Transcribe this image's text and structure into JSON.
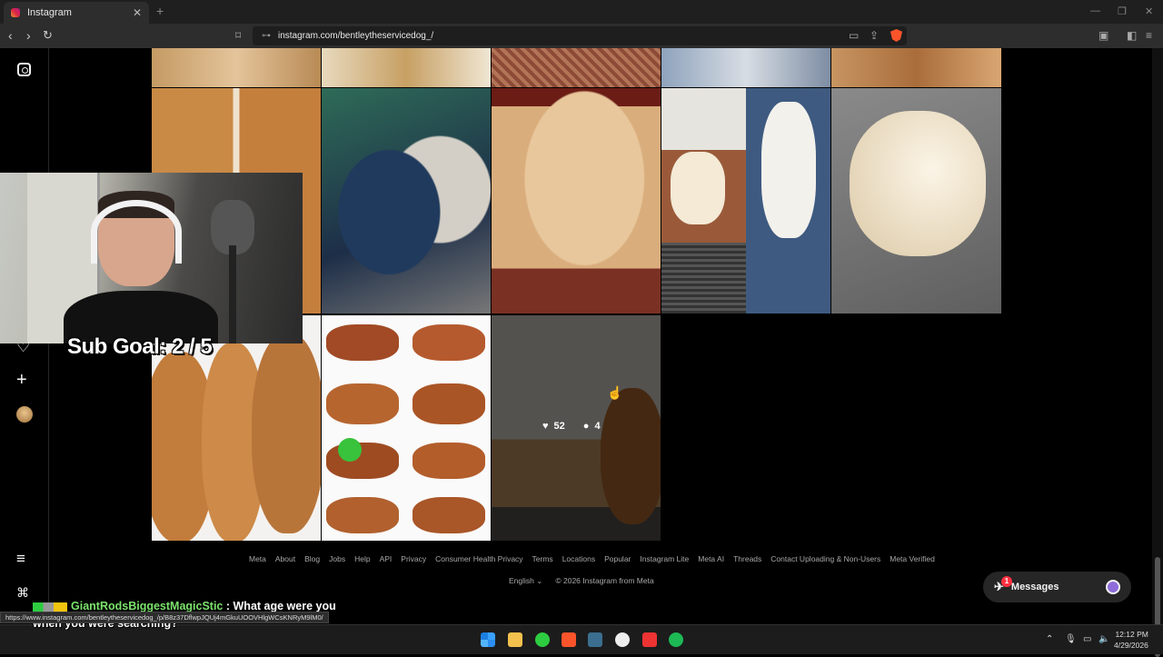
{
  "browser": {
    "tab_title": "Instagram",
    "tab_close": "✕",
    "new_tab": "+",
    "url": "instagram.com/bentleytheservicedog_/",
    "status_url": "https://www.instagram.com/bentleytheservicedog_/p/B8z37DflwpJQUj4mGkuUOOVHlgWCsKNRyM9lM0/"
  },
  "post_hover": {
    "likes": "52",
    "comments": "4"
  },
  "stream": {
    "sub_goal": "Sub Goal: 2 / 5",
    "chat_user": "GiantRodsBiggestMagicStic",
    "chat_message": ": What age were you when you were searching?"
  },
  "footer": {
    "links": [
      "Meta",
      "About",
      "Blog",
      "Jobs",
      "Help",
      "API",
      "Privacy",
      "Consumer Health Privacy",
      "Terms",
      "Locations",
      "Popular",
      "Instagram Lite",
      "Meta AI",
      "Threads",
      "Contact Uploading & Non-Users",
      "Meta Verified"
    ],
    "language": "English",
    "copyright": "© 2026 Instagram from Meta"
  },
  "messages": {
    "label": "Messages",
    "badge": "1"
  },
  "taskbar": {
    "time": "12:12 PM",
    "date": "4/29/2026"
  },
  "colors": {
    "accent_red": "#ff3040",
    "background": "#000000",
    "chat_user": "#7be36b"
  }
}
